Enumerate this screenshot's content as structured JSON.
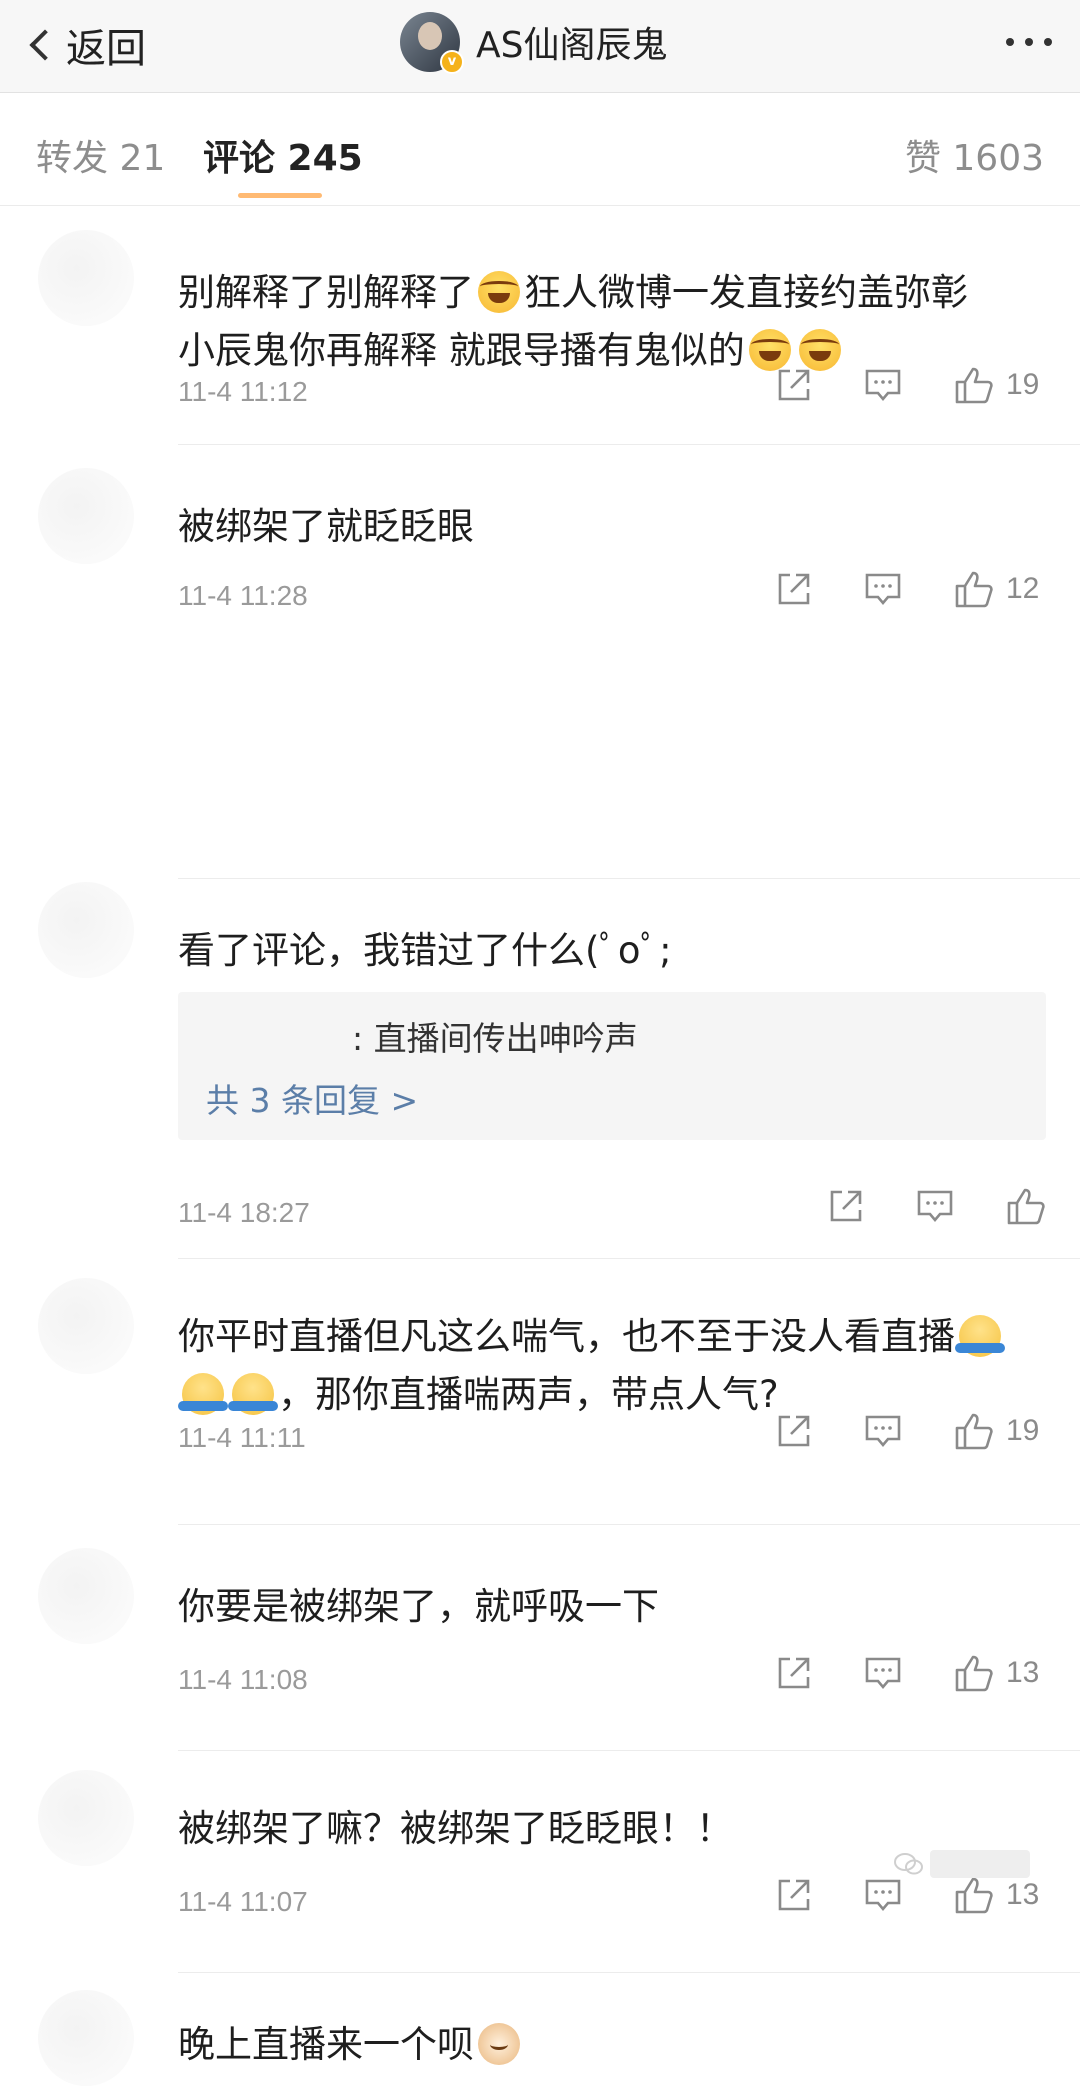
{
  "header": {
    "back_label": "返回",
    "author_name": "AS仙阁辰鬼"
  },
  "tabs": {
    "repost": "转发 21",
    "comment": "评论 245",
    "like": "赞 1603"
  },
  "comments": [
    {
      "text_parts": [
        "别解释了别解释了",
        "狂人微博一发直接约盖弥彰",
        "小辰鬼你再解释 就跟导播有鬼似的"
      ],
      "time": "11-4 11:12",
      "likes": "19"
    },
    {
      "text": "被绑架了就眨眨眼",
      "time": "11-4 11:28",
      "likes": "12"
    },
    {
      "text": "看了评论，我错过了什么(ﾟoﾟ;",
      "reply_preview": ": 直播间传出呻吟声",
      "reply_more": "共 3 条回复 >",
      "time": "11-4 18:27",
      "likes": ""
    },
    {
      "text_parts": [
        "你平时直播但凡这么喘气，也不至于没人看直播",
        "，那你直播喘两声，带点人气?"
      ],
      "time": "11-4 11:11",
      "likes": "19"
    },
    {
      "text": "你要是被绑架了，就呼吸一下",
      "time": "11-4 11:08",
      "likes": "13"
    },
    {
      "text": "被绑架了嘛？被绑架了眨眨眼！！",
      "time": "11-4 11:07",
      "likes": "13"
    },
    {
      "text": "晚上直播来一个呗"
    }
  ],
  "icons": {
    "repost": "share-icon",
    "reply": "comment-icon",
    "like": "thumbs-up-icon",
    "laugh_emoji": "laughing-crying-emoji-icon",
    "shrug_emoji": "shrug-emoji-icon",
    "cat_emoji": "cat-emoji-icon"
  },
  "colors": {
    "link": "#5b7ea8",
    "time": "#9a9a9a",
    "header_bg": "#f7f7f7"
  }
}
